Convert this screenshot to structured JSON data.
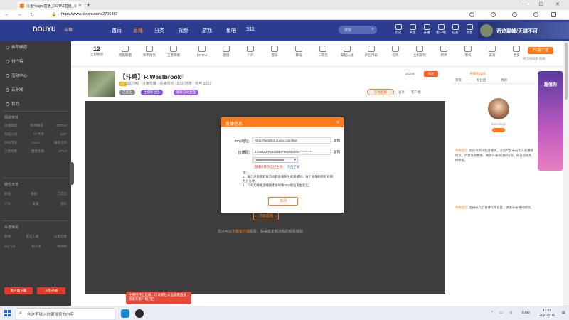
{
  "browser": {
    "tab_title": "斗鱼*sugar直播_DOTA2直播_斗鱼",
    "url": "https://www.douyu.com/2706482",
    "win_min": "—",
    "win_max": "☐",
    "win_close": "✕",
    "new_tab": "+",
    "tab_close": "✕"
  },
  "header": {
    "logo": "DOUYU",
    "logo_sub": "斗鱼",
    "nav": [
      "首页",
      "直播",
      "分类",
      "视频",
      "游戏",
      "鱼吧",
      "S11"
    ],
    "active_nav": "直播",
    "search_placeholder": "搜索",
    "icons": [
      "历史",
      "关注",
      "开播",
      "客户端",
      "任务",
      "消息"
    ],
    "banner_text": "奇迹巅峰/天谴不可"
  },
  "sidebar": {
    "items": [
      "推荐频道",
      "排行榜",
      "活动中心",
      "云游戏",
      "我的"
    ],
    "section1": "网游竞技",
    "rows1": [
      [
        "英雄联盟",
        "和平精英",
        "DOTA2"
      ],
      [
        "穿越火线",
        "CF手游",
        "DNF"
      ],
      [
        "炉石传说",
        "CSGO",
        "魔兽世界"
      ],
      [
        "王者荣耀",
        "魔兽争霸",
        "APEX"
      ]
    ],
    "section2": "娱乐天地",
    "rows2": [
      [
        "颜值",
        "舞蹈",
        "二次元"
      ],
      [
        "户外",
        "美食",
        "音乐"
      ]
    ],
    "section3": "手游休闲",
    "rows3": [
      [
        "原神",
        "第五人格",
        "火影忍者"
      ],
      [
        "QQ飞车",
        "狼人杀",
        "阴阳师"
      ]
    ],
    "btn_left": "客户端下载",
    "btn_right": "斗鱼开播"
  },
  "categories": {
    "first_num": "12",
    "first_label": "全部频道",
    "items": [
      "英雄联盟",
      "和平精英",
      "王者荣耀",
      "DOTA2",
      "颜值",
      "户外",
      "音乐",
      "舞蹈",
      "二次元",
      "穿越火线",
      "炉石传说",
      "吃鸡",
      "主机游戏",
      "原神",
      "单机",
      "美食",
      "更多"
    ],
    "pc_btn": "PC客户端",
    "pc_sub": "更流畅观看直播"
  },
  "room": {
    "title": "【斗鸡】R.Westbrook",
    "tag1": "举报",
    "line2": "DOTA2 · 斗鱼直播 ·  直播时长 · 5707热度 · 粉丝 9237",
    "lv": "LV",
    "pill1": "已关注",
    "pill2": "主播粉丝团",
    "pill3": "超级互动直播",
    "follow": "关注",
    "fans": "20348",
    "redtag": "在线直播",
    "report1": "分享",
    "report2": "客户端"
  },
  "player": {
    "button": "开启直播",
    "tip_prefix": "您还可以",
    "tip_link": "下载客户端",
    "tip_suffix": "观看，获得稳定和流畅的观看体验"
  },
  "dialog": {
    "title": "直播信息",
    "rtmp_label": "rtmp地址:",
    "rtmp_value": "rtmp://sendtc3.douyu.com/live",
    "key_label": "直播码:",
    "key_value": "2706482rPuxUxBnPYexSecret=**********",
    "copy": "复制",
    "select_arrow": "▾",
    "warn": "直播码修改后已生效",
    "warn_link": "点击了解",
    "note_title": "注：",
    "note1": "1、每次点击获取推流码都会重新生成直播码，每个直播码的有效期为分分钟。",
    "note2": "2、只有切换推流线路才会导致rtmp地址发生变化。",
    "close_btn": "关闭",
    "close_icon": "✕"
  },
  "right": {
    "tab1": "主播粉丝榜",
    "tab2": "贵宾",
    "tab3": "粉丝团",
    "tab4": "周榜",
    "name": "kamisbuyi",
    "msg1_h": "系统提示:",
    "msg1": "欢迎来到斗鱼直播间，斗鱼严禁未成年人直播或打赏，严禁低俗色情、赌博诈骗等违规内容，如发现请及时举报。",
    "msg2_h": "系统提示:",
    "msg2": "主播开启了直播权限设置，请遵守直播间规则。"
  },
  "ad": {
    "text": "超值购"
  },
  "taskbar": {
    "search_placeholder": "在这里输入你要搜索的内容",
    "tray_lang": "ENG",
    "time": "13:59",
    "date": "2021/11/6"
  },
  "toast": "主播已开启直播，可以前往斗鱼观看直播或者在客户端开启"
}
